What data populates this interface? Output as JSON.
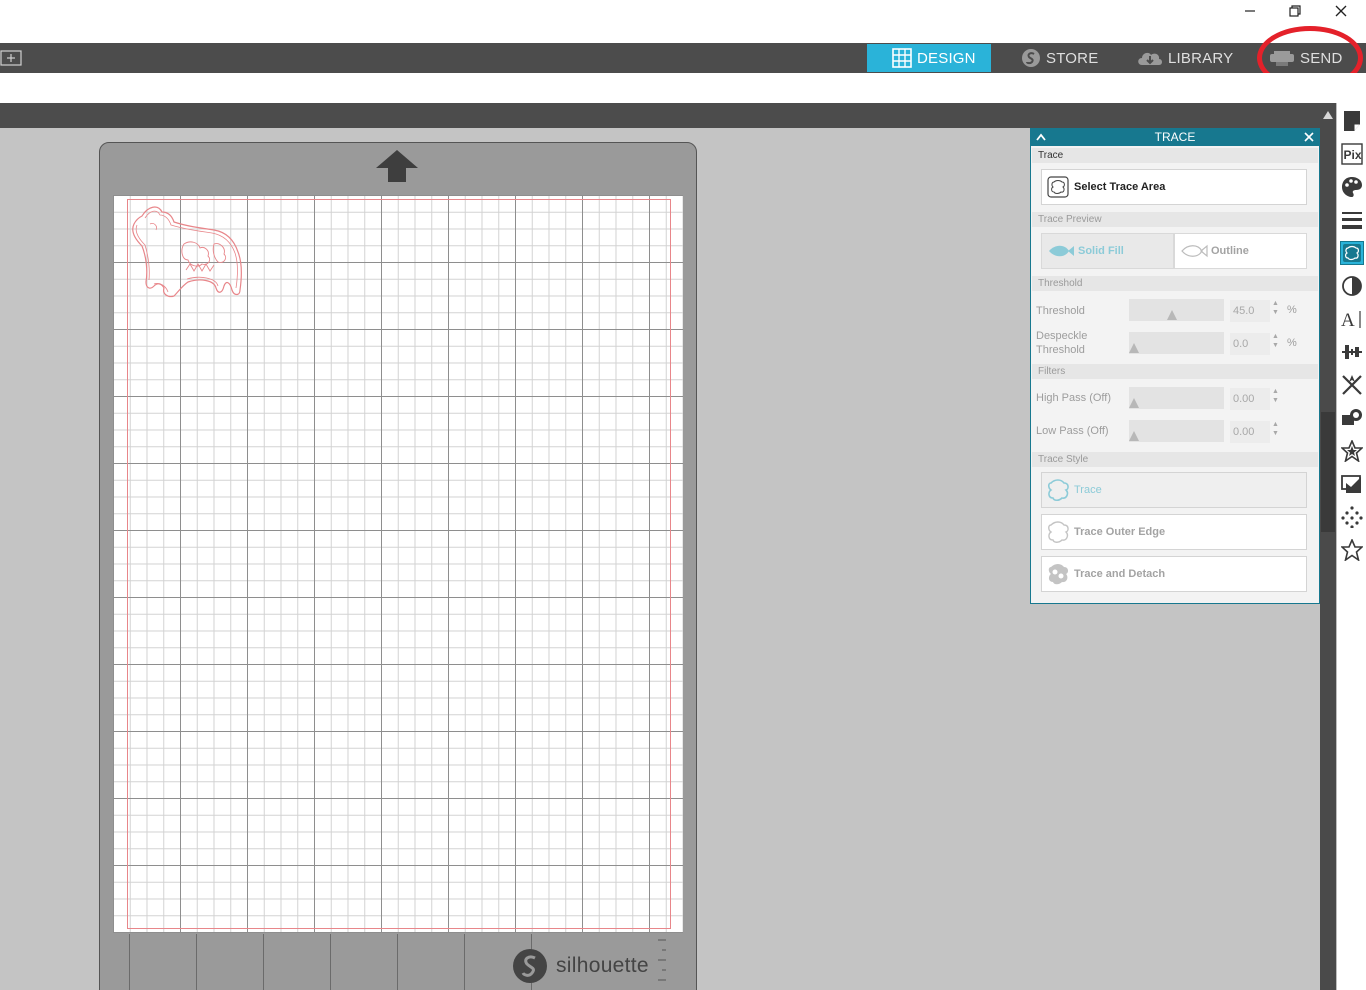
{
  "nav": {
    "tabs": [
      {
        "label": "DESIGN",
        "icon": "grid-icon"
      },
      {
        "label": "STORE",
        "icon": "silhouette-s-icon"
      },
      {
        "label": "LIBRARY",
        "icon": "cloud-download-icon"
      },
      {
        "label": "SEND",
        "icon": "cutter-icon"
      }
    ],
    "active_tab": "DESIGN"
  },
  "mat": {
    "brand": "silhouette"
  },
  "trace_panel": {
    "title": "TRACE",
    "section_trace": "Trace",
    "select_trace_area": "Select Trace Area",
    "section_preview": "Trace Preview",
    "solid_fill": "Solid Fill",
    "outline": "Outline",
    "section_threshold": "Threshold",
    "threshold_label": "Threshold",
    "threshold_value": "45.0",
    "threshold_unit": "%",
    "despeckle_label": "Despeckle Threshold",
    "despeckle_value": "0.0",
    "despeckle_unit": "%",
    "section_filters": "Filters",
    "high_pass_label": "High Pass (Off)",
    "high_pass_value": "0.00",
    "low_pass_label": "Low Pass (Off)",
    "low_pass_value": "0.00",
    "section_style": "Trace Style",
    "style_trace": "Trace",
    "style_outer_edge": "Trace Outer Edge",
    "style_detach": "Trace and Detach"
  },
  "slider_levels": {
    "threshold": 0.45,
    "despeckle": 0.0,
    "high_pass": 0.0,
    "low_pass": 0.0
  },
  "rail_icons": [
    "page-setup-icon",
    "pixscan-icon",
    "fill-color-icon",
    "line-style-icon",
    "trace-icon",
    "contrast-icon",
    "text-style-icon",
    "align-icon",
    "transform-icon",
    "replicate-icon",
    "modify-star-icon",
    "offset-icon",
    "sketch-dots-icon",
    "favorites-star-icon"
  ],
  "colors": {
    "accent": "#2ab3d9",
    "panel_header": "#17788f",
    "annotation": "#e4212a",
    "cut_line": "#e8868a"
  }
}
